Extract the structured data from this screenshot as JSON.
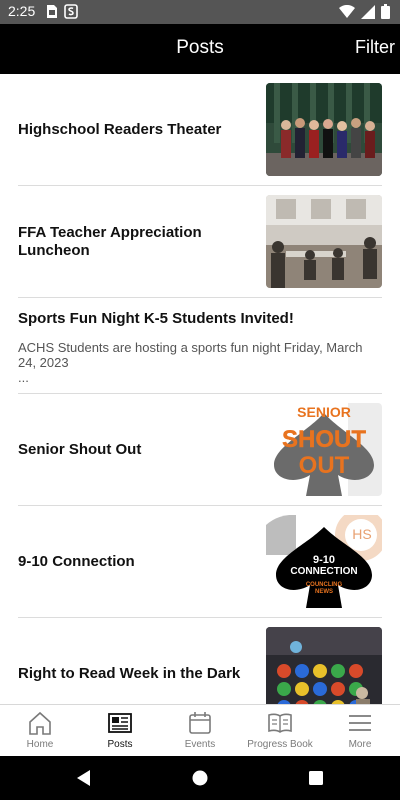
{
  "status_bar": {
    "time": "2:25"
  },
  "app_bar": {
    "title": "Posts",
    "filter_label": "Filter"
  },
  "posts": [
    {
      "title": "Highschool Readers Theater"
    },
    {
      "title": "FFA Teacher Appreciation Luncheon"
    },
    {
      "title": "Sports Fun Night K-5 Students Invited!",
      "excerpt": "ACHS Students are hosting a sports fun night Friday, March 24, 2023",
      "ellipsis": "..."
    },
    {
      "title": "Senior Shout Out",
      "thumb_text": [
        "SENIOR",
        "SHOUT",
        "OUT"
      ]
    },
    {
      "title": "9-10 Connection",
      "thumb_text": [
        "HS",
        "9-10",
        "CONNECTION",
        "COUNCLING",
        "NEWS"
      ]
    },
    {
      "title": "Right to Read Week in the Dark"
    }
  ],
  "bottom_nav": {
    "items": [
      {
        "label": "Home",
        "icon": "home-icon"
      },
      {
        "label": "Posts",
        "icon": "newspaper-icon",
        "active": true
      },
      {
        "label": "Events",
        "icon": "calendar-icon"
      },
      {
        "label": "Progress Book",
        "icon": "book-icon"
      },
      {
        "label": "More",
        "icon": "menu-icon"
      }
    ]
  },
  "colors": {
    "app_bar": "#000000",
    "status_bar": "#555555",
    "accent_orange": "#e8731f",
    "spade_gray": "#6b6b6b"
  }
}
